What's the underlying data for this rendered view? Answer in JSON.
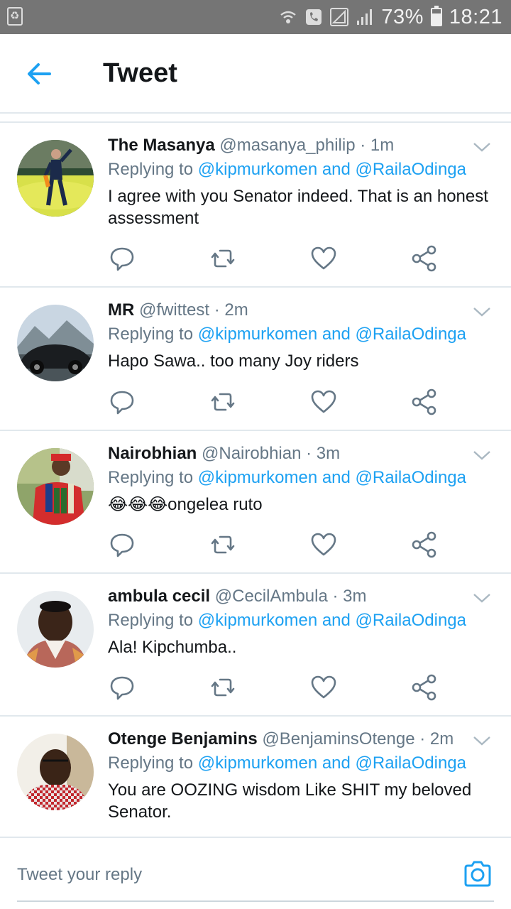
{
  "status_bar": {
    "battery": "73%",
    "time": "18:21"
  },
  "header": {
    "title": "Tweet"
  },
  "tweets": [
    {
      "name": "The Masanya",
      "handle": "@masanya_philip",
      "time": "· 1m",
      "replying_prefix": "Replying to ",
      "replying_links": "@kipmurkomen and @RailaOdinga",
      "text": "I agree with you Senator indeed. That is an honest assessment"
    },
    {
      "name": "MR",
      "handle": "@fwittest",
      "time": "· 2m",
      "replying_prefix": "Replying to ",
      "replying_links": "@kipmurkomen and @RailaOdinga",
      "text": "Hapo Sawa.. too many Joy riders"
    },
    {
      "name": "Nairobhian",
      "handle": "@Nairobhian",
      "time": "· 3m",
      "replying_prefix": "Replying to ",
      "replying_links": "@kipmurkomen and @RailaOdinga",
      "text": "😂😂😂ongelea ruto"
    },
    {
      "name": "ambula cecil",
      "handle": "@CecilAmbula",
      "time": "· 3m",
      "replying_prefix": "Replying to ",
      "replying_links": "@kipmurkomen and @RailaOdinga",
      "text": "Ala! Kipchumba.."
    },
    {
      "name": "Otenge Benjamins",
      "handle": "@BenjaminsOtenge",
      "time": "· 2m",
      "replying_prefix": "Replying to ",
      "replying_links": "@kipmurkomen and @RailaOdinga",
      "text": "You are OOZING wisdom Like SHIT my beloved Senator."
    }
  ],
  "reply_bar": {
    "placeholder": "Tweet your reply"
  },
  "colors": {
    "accent": "#1da1f2",
    "secondary_text": "#657786",
    "primary_text": "#14171a",
    "divider": "#e1e8ed",
    "status_bar": "#757575"
  },
  "icons": [
    "back-arrow-icon",
    "reply-icon",
    "retweet-icon",
    "like-icon",
    "share-icon",
    "chevron-down-icon",
    "camera-icon",
    "wifi-call-icon",
    "phone-icon",
    "signal-icon",
    "battery-icon"
  ]
}
